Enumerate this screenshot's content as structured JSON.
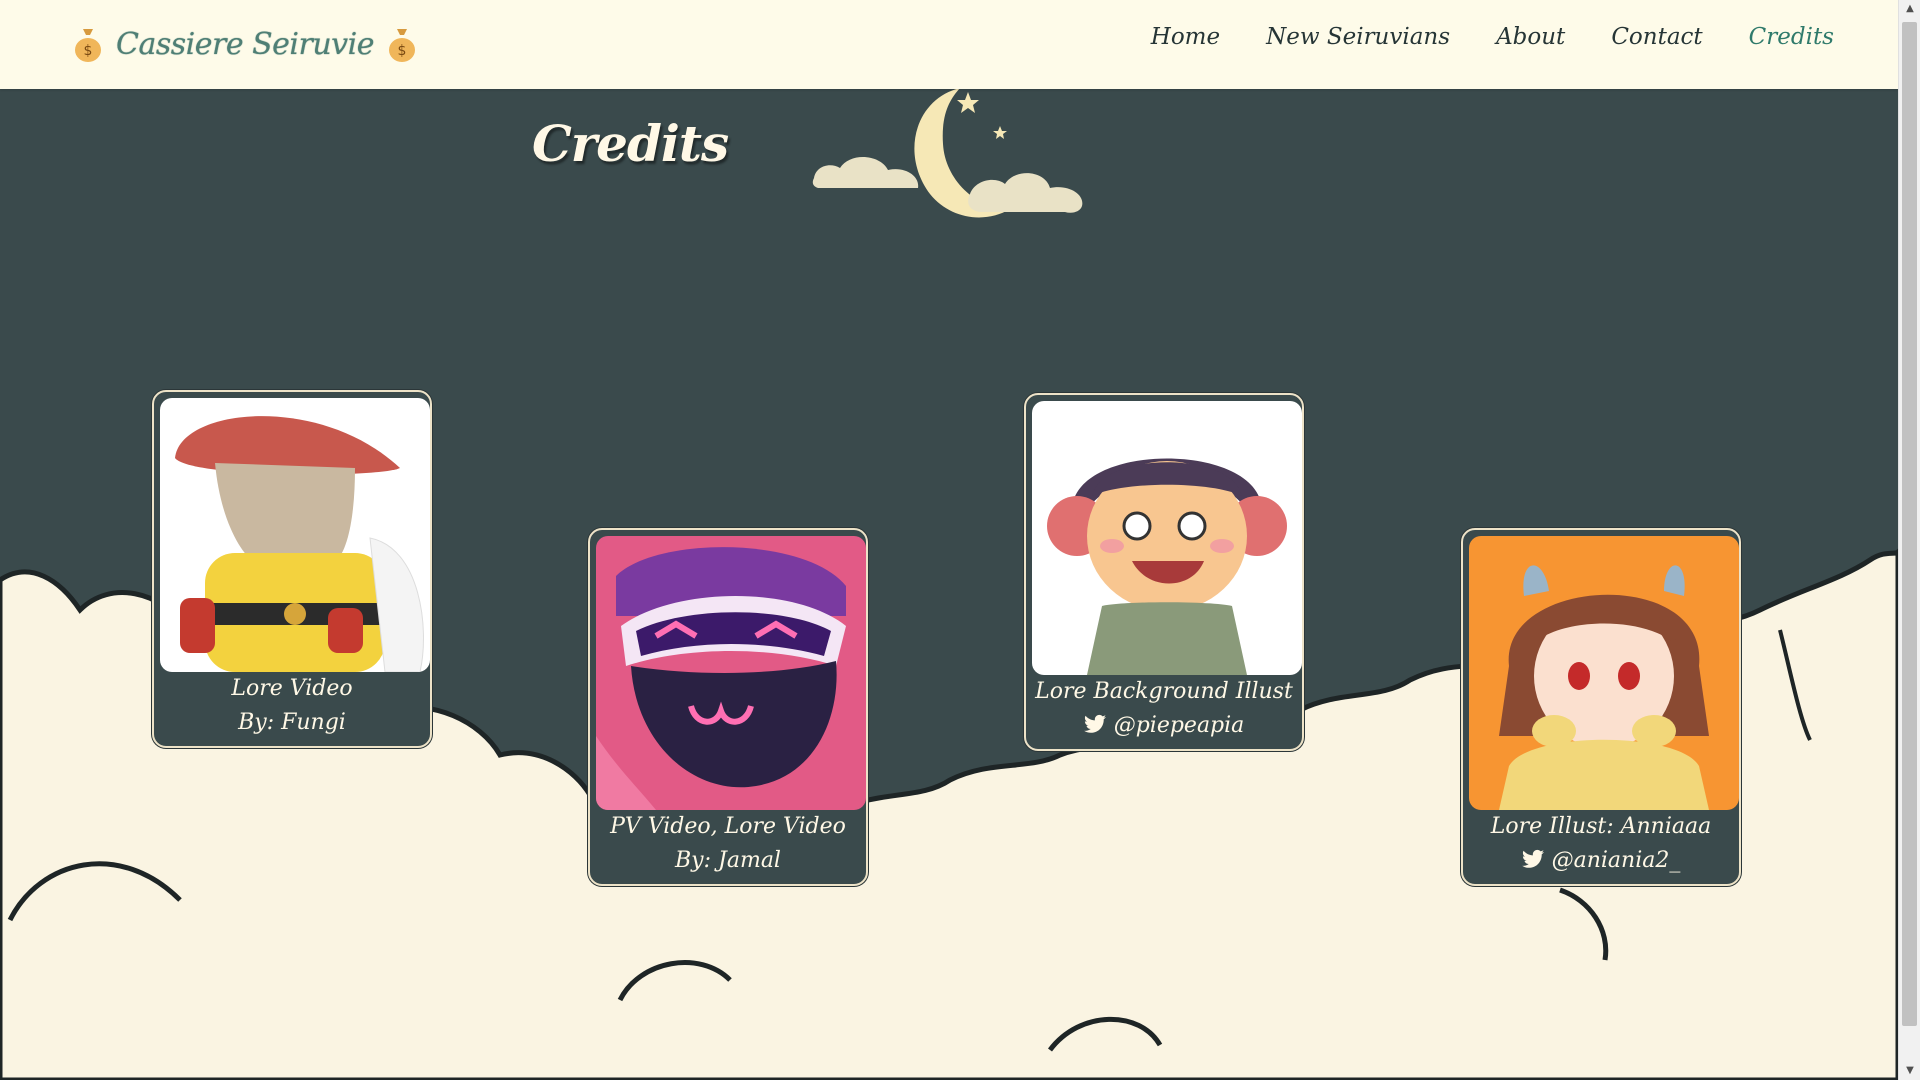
{
  "brand": {
    "name": "Cassiere Seiruvie",
    "icon": "money-bag-icon"
  },
  "nav": {
    "items": [
      {
        "label": "Home"
      },
      {
        "label": "New Seiruvians"
      },
      {
        "label": "About"
      },
      {
        "label": "Contact"
      },
      {
        "label": "Credits",
        "active": true
      }
    ]
  },
  "page": {
    "title": "Credits"
  },
  "cards": [
    {
      "image": "mushroom-character-image",
      "line1": "Lore Video",
      "line2": "By: Fungi",
      "icon": null
    },
    {
      "image": "goggles-character-image",
      "line1": "PV Video, Lore Video",
      "line2": "By: Jamal",
      "icon": null
    },
    {
      "image": "headphones-character-image",
      "line1": "Lore Background Illust",
      "line2": "@piepeapia",
      "icon": "twitter-icon"
    },
    {
      "image": "horned-girl-image",
      "line1": "Lore Illust: Anniaaa",
      "line2": "@aniania2_",
      "icon": "twitter-icon"
    }
  ],
  "colors": {
    "background": "#3a4a4c",
    "header": "#fefbe9",
    "accent": "#2f7a6b",
    "cloud": "#faf4e2",
    "text_light": "#fff8e6"
  }
}
